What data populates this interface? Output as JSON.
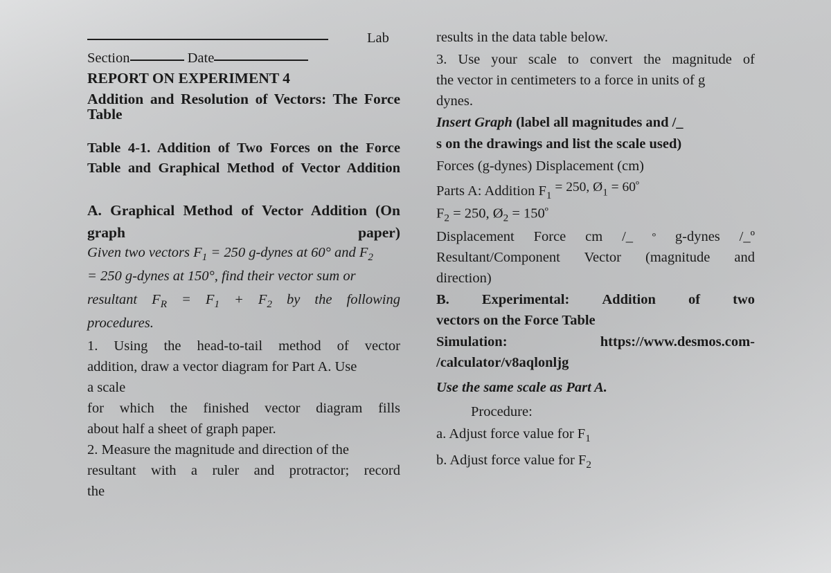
{
  "document": {
    "title": "REPORT ON EXPERIMENT 4",
    "subtitle": "Addition and Resolution of Vectors: The Force Table",
    "lab_label": "Lab",
    "section_label": "Section",
    "date_label": "Date"
  },
  "left_column": {
    "table_caption": "Table 4-1. Addition of Two Forces on the Force Table and Graphical Method of Vector Addition",
    "section_a_heading": "A. Graphical Method of Vector Addition (On graph paper)",
    "given_statement": {
      "l1_a": "Given two vectors F",
      "l1_sub1": "1",
      "l1_b": " = 250 g-dynes at 60° and F",
      "l1_sub2": "2",
      "l2": "= 250 g-dynes at 150°, find their vector sum or",
      "l3_a": "resultant",
      "l3_fr": "F",
      "l3_fr_sub": "R",
      "l3_eq": "=",
      "l3_f1": "F",
      "l3_f1_sub": "1",
      "l3_plus": "+",
      "l3_f2": "F",
      "l3_f2_sub": "2",
      "l3_tail_1": "by",
      "l3_tail_2": "the",
      "l3_tail_3": "following",
      "l4": "procedures."
    },
    "step_1": {
      "l1": "1. Using the head-to-tail method of vector",
      "l2": "addition, draw a vector diagram for Part A. Use",
      "l3": "a scale",
      "l4": "for which the finished vector diagram fills",
      "l5": "about half a sheet of graph paper."
    },
    "step_2": {
      "l1": "2. Measure the magnitude and direction of the",
      "l2": "resultant with a ruler and protractor; record",
      "l3": "the"
    }
  },
  "right_column": {
    "step_2_cont": "results in the data table below.",
    "step_3": {
      "l1": "3. Use your scale to convert the magnitude of",
      "l2": "the vector in centimeters to a force in units of g",
      "l3": "dynes."
    },
    "insert_graph": {
      "emphasis": "Insert Graph",
      "l1_rest": " (label all magnitudes and /_",
      "l2": "s on the drawings and list the scale used)"
    },
    "units_line": "Forces (g-dynes) Displacement (cm)",
    "parts_a": {
      "prefix": "Parts A: Addition F",
      "sub1": "1",
      "value1": " = 250, Ø",
      "sub2": "1",
      "value2": " = 60",
      "ord": "º"
    },
    "f2_line": {
      "f": "F",
      "sub1": "2",
      "mid": " = 250, Ø",
      "sub2": "2",
      "tail": " = 150",
      "ord": "º"
    },
    "measure_row": {
      "c1": "Displacement",
      "c2": "Force",
      "c3": "cm",
      "c4": "/_",
      "c5": "º",
      "c6": "g-dynes",
      "c7": "/_º"
    },
    "resultant_note": {
      "l1": "Resultant/Component Vector (magnitude and",
      "l2": "direction)"
    },
    "section_b": {
      "l1_1": "B.",
      "l1_2": "Experimental:",
      "l1_3": "Addition",
      "l1_4": "of",
      "l1_5": "two",
      "l2": "vectors on the Force Table"
    },
    "simulation": {
      "l1": "Simulation: https://www.desmos.com-",
      "l2": "/calculator/v8aqlonljg"
    },
    "scale_note": "Use the same scale as Part A.",
    "procedure_label": "Procedure:",
    "procedure_items": {
      "a_text": "a. Adjust force value for F",
      "a_sub": "1",
      "b_text": "b. Adjust force value for F",
      "b_sub": "2"
    }
  },
  "colors": {
    "background": "#c9cacb",
    "text": "#1a1a1a"
  }
}
